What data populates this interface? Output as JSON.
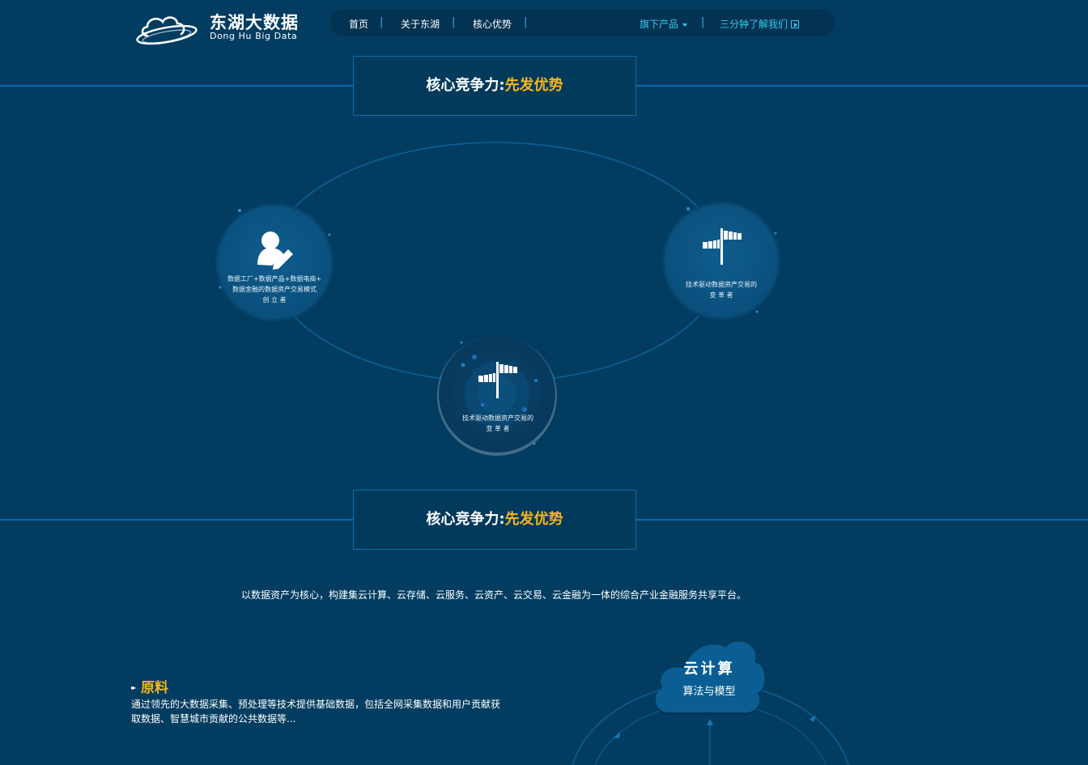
{
  "header": {
    "logo_title": "东湖大数据",
    "logo_subtitle": "Dong Hu Big Data",
    "logo_icon": "cloud-orbit-icon",
    "nav": [
      {
        "label": "首页"
      },
      {
        "label": "关于东湖"
      },
      {
        "label": "核心优势"
      },
      {
        "label": "旗下产品"
      },
      {
        "label": "三分钟了解我们"
      }
    ],
    "dropdown_icon": "caret-down-icon",
    "play_icon": "play-icon"
  },
  "section1": {
    "title_white": "核心竞争力:",
    "title_highlight": "先发优势"
  },
  "diagram": {
    "nodes": [
      {
        "icon": "user-edit-icon",
        "line1": "数据工厂+数据产品+数据电商+",
        "line2": "数据金融的数据资产交易模式",
        "line3": "创 立 者"
      },
      {
        "icon": "windsock-icon",
        "line1": "技术驱动数据资产交易的",
        "line2": "变 革 者"
      },
      {
        "icon": "windsock-icon",
        "line1": "技术驱动数据资产交易的",
        "line2": "变 革 者"
      }
    ]
  },
  "section2": {
    "title_white": "核心竞争力:",
    "title_highlight": "先发优势"
  },
  "intro": "以数据资产为核心，构建集云计算、云存储、云服务、云资产、云交易、云金融为一体的综合产业金融服务共享平台。",
  "yuanliao": {
    "title": "原料",
    "text": "通过领先的大数据采集、预处理等技术提供基础数据，包括全网采集数据和用户贡献获取数据、智慧城市贡献的公共数据等..."
  },
  "cloud": {
    "title": "云计算",
    "subtitle": "算法与模型"
  },
  "colors": {
    "background": "#023d61",
    "accent_yellow": "#f5b41d",
    "accent_cyan": "#37c8f0",
    "line_blue": "#0a6bab"
  }
}
